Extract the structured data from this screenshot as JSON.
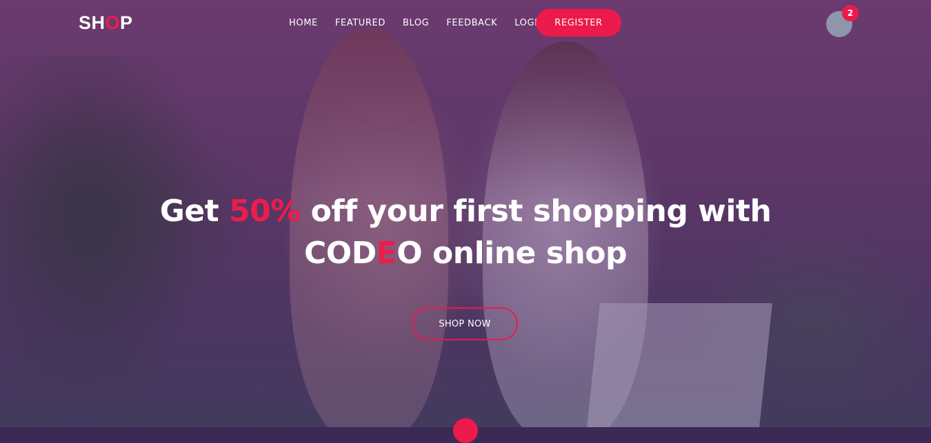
{
  "header": {
    "logo_part1": "SH",
    "logo_accent": "O",
    "logo_part2": "P",
    "nav": [
      {
        "label": "HOME"
      },
      {
        "label": "FEATURED"
      },
      {
        "label": "BLOG"
      },
      {
        "label": "FEEDBACK"
      },
      {
        "label": "LOGIN"
      }
    ],
    "register_label": "REGISTER",
    "cart_count": "2"
  },
  "hero": {
    "line1_pre": "Get ",
    "line1_accent": "50%",
    "line1_post": " off your first shopping with",
    "line2_pre": "COD",
    "line2_accent": "E",
    "line2_post": "O online shop",
    "cta_label": "SHOP NOW"
  },
  "colors": {
    "accent": "#ec1a4b",
    "avatar": "#8d96ab"
  }
}
